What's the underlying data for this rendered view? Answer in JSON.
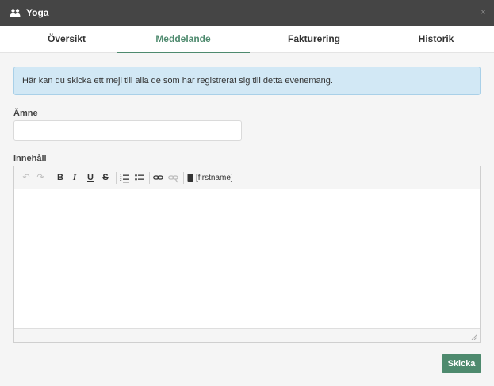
{
  "window": {
    "title": "Yoga",
    "close_glyph": "×",
    "icon": "people-icon"
  },
  "tabs": [
    {
      "label": "Översikt",
      "active": false
    },
    {
      "label": "Meddelande",
      "active": true
    },
    {
      "label": "Fakturering",
      "active": false
    },
    {
      "label": "Historik",
      "active": false
    }
  ],
  "info_message": "Här kan du skicka ett mejl till alla de som har registrerat sig till detta evenemang.",
  "subject": {
    "label": "Ämne",
    "value": "",
    "placeholder": ""
  },
  "body": {
    "label": "Innehåll",
    "value": ""
  },
  "toolbar": {
    "undo_icon": "↶",
    "redo_icon": "↷",
    "bold": "B",
    "italic": "I",
    "underline": "U",
    "strike": "S",
    "placeholder_label": "[firstname]"
  },
  "send_label": "Skicka",
  "colors": {
    "accent": "#4e8a6e",
    "titlebar": "#454545",
    "info_bg": "#d2e8f5"
  }
}
